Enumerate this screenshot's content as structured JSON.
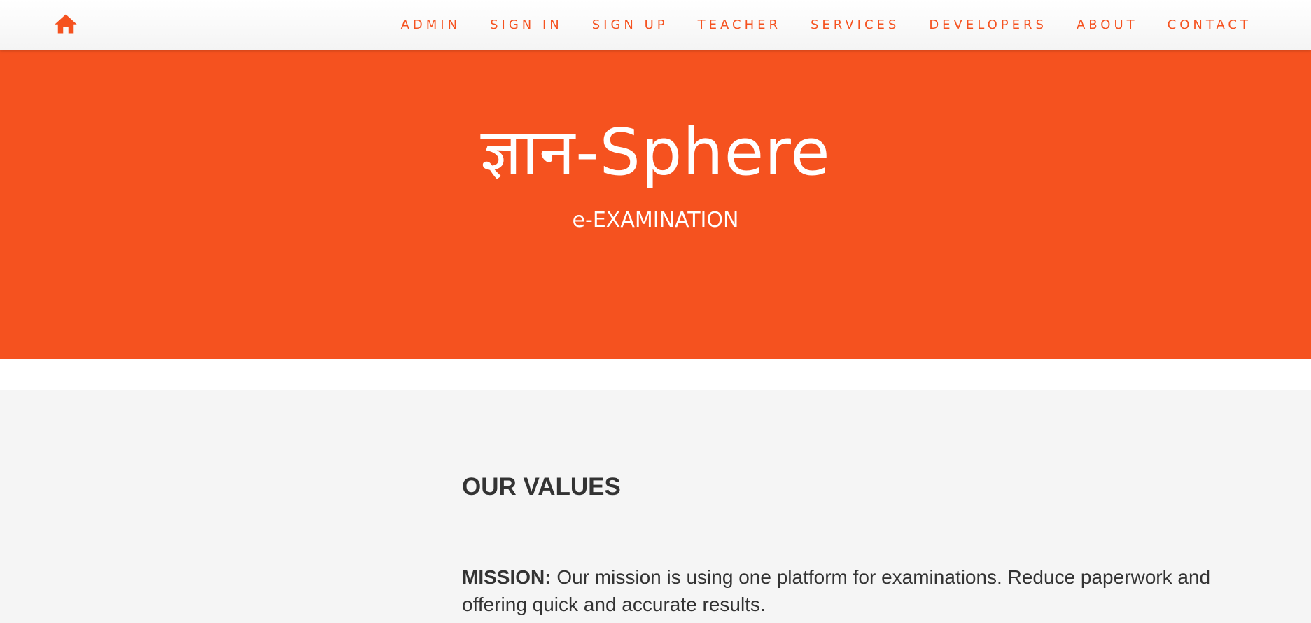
{
  "colors": {
    "brand": "#f5521f",
    "hero_text": "#ffffff",
    "section_bg": "#f5f5f5",
    "body_text": "#333333"
  },
  "navbar": {
    "home_icon": "home-icon",
    "items": [
      {
        "label": "ADMIN"
      },
      {
        "label": "SIGN IN"
      },
      {
        "label": "SIGN UP"
      },
      {
        "label": "TEACHER"
      },
      {
        "label": "SERVICES"
      },
      {
        "label": "DEVELOPERS"
      },
      {
        "label": "ABOUT"
      },
      {
        "label": "CONTACT"
      }
    ]
  },
  "hero": {
    "title": "ज्ञान-Sphere",
    "subtitle": "e-EXAMINATION"
  },
  "values": {
    "heading": "OUR VALUES",
    "mission_label": "MISSION:",
    "mission_text": " Our mission is using one platform for examinations. Reduce paperwork and offering quick and accurate results."
  }
}
